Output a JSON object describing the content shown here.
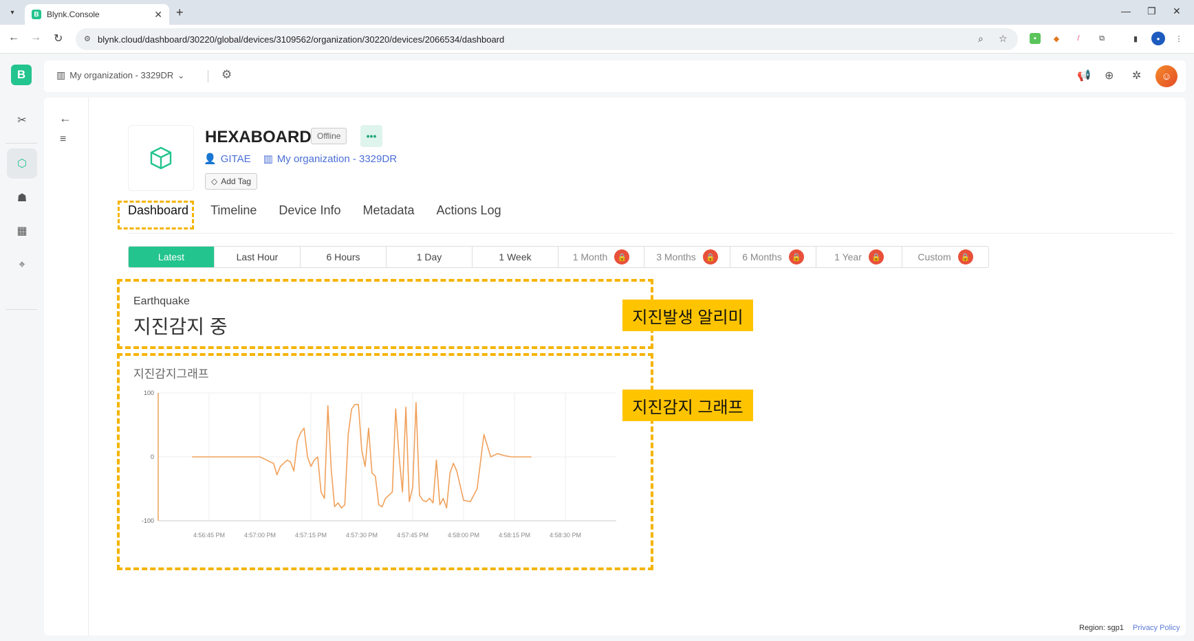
{
  "browser": {
    "tab_title": "Blynk.Console",
    "url": "blynk.cloud/dashboard/30220/global/devices/3109562/organization/30220/devices/2066534/dashboard"
  },
  "topbar": {
    "org_name": "My organization - 3329DR"
  },
  "device": {
    "name": "HEXABOARD",
    "status": "Offline",
    "owner": "GITAE",
    "organization": "My organization - 3329DR",
    "add_tag": "Add Tag"
  },
  "tabs": [
    "Dashboard",
    "Timeline",
    "Device Info",
    "Metadata",
    "Actions Log"
  ],
  "ranges": [
    {
      "label": "Latest",
      "locked": false
    },
    {
      "label": "Last Hour",
      "locked": false
    },
    {
      "label": "6 Hours",
      "locked": false
    },
    {
      "label": "1 Day",
      "locked": false
    },
    {
      "label": "1 Week",
      "locked": false
    },
    {
      "label": "1 Month",
      "locked": true
    },
    {
      "label": "3 Months",
      "locked": true
    },
    {
      "label": "6 Months",
      "locked": true
    },
    {
      "label": "1 Year",
      "locked": true
    },
    {
      "label": "Custom",
      "locked": true
    }
  ],
  "widget_value": {
    "label": "Earthquake",
    "value": "지진감지 중"
  },
  "callouts": {
    "value_note": "지진발생 알리미",
    "chart_note": "지진감지 그래프"
  },
  "footer": {
    "region": "Region: sgp1",
    "privacy": "Privacy Policy"
  },
  "colors": {
    "accent": "#23c48e",
    "highlight": "#f5b400",
    "line": "#f0a05a"
  },
  "chart_data": {
    "type": "line",
    "title": "지진감지그래프",
    "xlabel": "",
    "ylabel": "",
    "ylim": [
      -100,
      100
    ],
    "y_ticks": [
      "100",
      "0",
      "-100"
    ],
    "x_ticks": [
      "4:56:45 PM",
      "4:57:00 PM",
      "4:57:15 PM",
      "4:57:30 PM",
      "4:57:45 PM",
      "4:58:00 PM",
      "4:58:15 PM",
      "4:58:30 PM"
    ],
    "series": [
      {
        "x": [
          -20,
          -10,
          -5,
          0,
          2,
          3,
          4,
          5,
          6,
          7,
          8,
          9,
          10,
          11,
          12,
          13,
          14,
          15,
          16,
          17,
          18,
          19,
          20,
          21,
          22,
          23,
          24,
          25,
          26,
          27,
          28,
          29,
          30,
          31,
          32,
          33,
          34,
          35,
          36,
          37,
          38,
          39,
          40,
          41,
          42,
          43,
          44,
          45,
          46,
          47,
          48,
          49,
          50,
          51,
          52,
          53,
          54,
          55,
          56,
          57,
          58,
          60,
          62,
          64,
          66,
          68,
          70,
          72,
          74,
          76,
          78,
          80
        ],
        "y": [
          0,
          0,
          0,
          0,
          -5,
          -8,
          -10,
          -28,
          -15,
          -10,
          -5,
          -8,
          -22,
          25,
          38,
          45,
          0,
          -15,
          -5,
          0,
          -55,
          -65,
          80,
          -20,
          -78,
          -72,
          -80,
          -75,
          35,
          75,
          82,
          82,
          10,
          -15,
          45,
          -25,
          -30,
          -75,
          -78,
          -65,
          -60,
          -55,
          75,
          0,
          -55,
          78,
          -70,
          -48,
          85,
          -60,
          -68,
          -70,
          -65,
          -72,
          -5,
          -75,
          -65,
          -80,
          -25,
          -10,
          -22,
          -68,
          -70,
          -50,
          35,
          0,
          5,
          2,
          0,
          0,
          0,
          0
        ]
      }
    ]
  }
}
